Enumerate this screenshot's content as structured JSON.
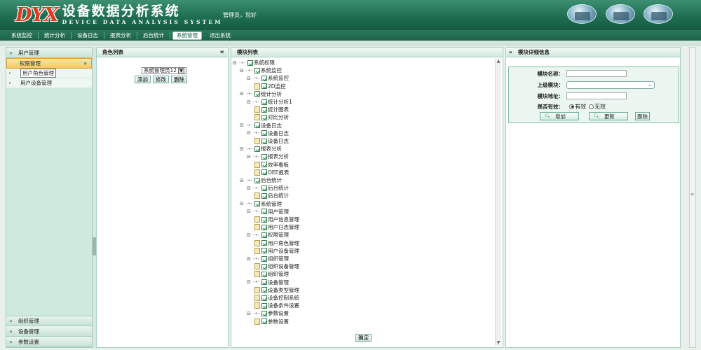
{
  "header": {
    "logo_mark": "DYX",
    "title": "设备数据分析系统",
    "subtitle": "DEVICE DATA ANALYSIS SYSTEM",
    "greeting": "管理员，您好"
  },
  "nav": {
    "items": [
      "系统监控",
      "统计分析",
      "设备日志",
      "报表分析",
      "后台统计",
      "系统管理",
      "退出系统"
    ],
    "active_index": 5
  },
  "sidebar": {
    "top_group": "用户管理",
    "active_item": "权限管理",
    "sub_items": [
      "用户角色管理",
      "用户设备管理"
    ],
    "bottom_groups": [
      "组织管理",
      "设备管理",
      "参数设置"
    ]
  },
  "role_panel": {
    "title": "角色列表",
    "select_value": "系统管理员12",
    "buttons": [
      "添加",
      "修改",
      "删除"
    ]
  },
  "module_panel": {
    "title": "模块列表",
    "confirm_label": "确定",
    "tree": [
      {
        "label": "系统权限",
        "level": 0,
        "kind": "root"
      },
      {
        "label": "系统监控",
        "level": 1,
        "kind": "folder"
      },
      {
        "label": "系统监控",
        "level": 2,
        "kind": "folder"
      },
      {
        "label": "2D监控",
        "level": 3,
        "kind": "leaf"
      },
      {
        "label": "统计分析",
        "level": 1,
        "kind": "folder"
      },
      {
        "label": "统计分析1",
        "level": 2,
        "kind": "folder"
      },
      {
        "label": "统计图表",
        "level": 3,
        "kind": "leaf"
      },
      {
        "label": "对比分析",
        "level": 3,
        "kind": "leaf"
      },
      {
        "label": "设备日志",
        "level": 1,
        "kind": "folder"
      },
      {
        "label": "设备日志",
        "level": 2,
        "kind": "folder"
      },
      {
        "label": "设备日志",
        "level": 3,
        "kind": "leaf"
      },
      {
        "label": "报表分析",
        "level": 1,
        "kind": "folder"
      },
      {
        "label": "报表分析",
        "level": 2,
        "kind": "folder"
      },
      {
        "label": "效率看板",
        "level": 3,
        "kind": "leaf"
      },
      {
        "label": "OEE报表",
        "level": 3,
        "kind": "leaf"
      },
      {
        "label": "后台统计",
        "level": 1,
        "kind": "folder"
      },
      {
        "label": "后台统计",
        "level": 2,
        "kind": "folder"
      },
      {
        "label": "后台统计",
        "level": 3,
        "kind": "leaf"
      },
      {
        "label": "系统管理",
        "level": 1,
        "kind": "folder"
      },
      {
        "label": "用户管理",
        "level": 2,
        "kind": "folder"
      },
      {
        "label": "用户信息管理",
        "level": 3,
        "kind": "leaf"
      },
      {
        "label": "用户日志管理",
        "level": 3,
        "kind": "leaf"
      },
      {
        "label": "权限管理",
        "level": 2,
        "kind": "folder"
      },
      {
        "label": "用户角色管理",
        "level": 3,
        "kind": "leaf"
      },
      {
        "label": "用户设备管理",
        "level": 3,
        "kind": "leaf"
      },
      {
        "label": "组织管理",
        "level": 2,
        "kind": "folder"
      },
      {
        "label": "组织设备管理",
        "level": 3,
        "kind": "leaf"
      },
      {
        "label": "组织管理",
        "level": 3,
        "kind": "leaf"
      },
      {
        "label": "设备管理",
        "level": 2,
        "kind": "folder"
      },
      {
        "label": "设备类型管理",
        "level": 3,
        "kind": "leaf"
      },
      {
        "label": "设备控制系统",
        "level": 3,
        "kind": "leaf"
      },
      {
        "label": "设备条件设置",
        "level": 3,
        "kind": "leaf"
      },
      {
        "label": "参数设置",
        "level": 2,
        "kind": "folder"
      },
      {
        "label": "参数设置",
        "level": 3,
        "kind": "leaf"
      }
    ]
  },
  "detail_panel": {
    "title": "模块详细信息",
    "labels": {
      "name": "模块名称：",
      "parent": "上级模块：",
      "address": "模块地址：",
      "valid": "是否有效："
    },
    "radio_valid": "有效",
    "radio_invalid": "无效",
    "valid_selected": true,
    "btn_add": "增加",
    "btn_update": "更新",
    "btn_delete": "删除"
  }
}
